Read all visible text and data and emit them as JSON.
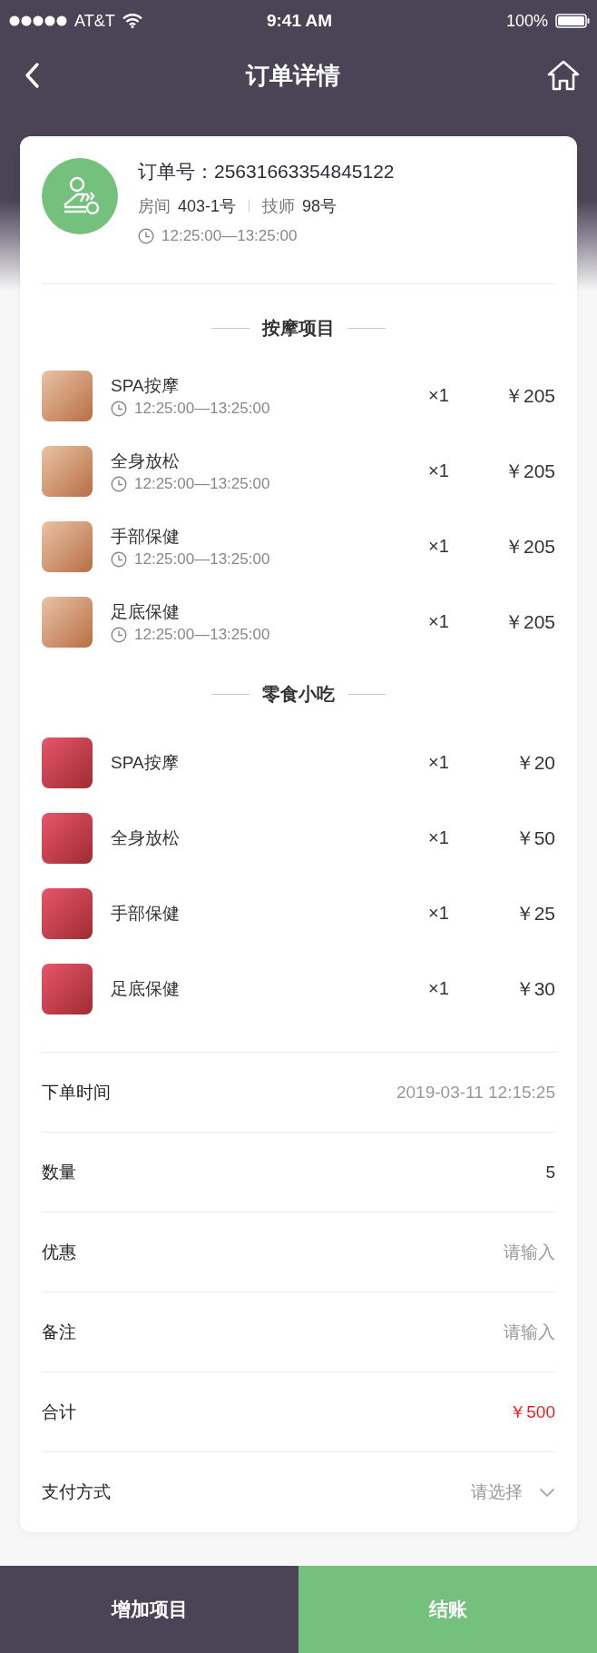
{
  "status_bar": {
    "carrier": "AT&T",
    "time": "9:41 AM",
    "battery": "100%"
  },
  "nav": {
    "title": "订单详情"
  },
  "order": {
    "number": "订单号：25631663354845122",
    "room_label": "房间",
    "room": "403-1号",
    "tech_label": "技师",
    "tech": "98号",
    "time": "12:25:00—13:25:00"
  },
  "sections": [
    {
      "title": "按摩项目",
      "kind": "service",
      "items": [
        {
          "name": "SPA按摩",
          "time": "12:25:00—13:25:00",
          "qty": "×1",
          "price": "￥205"
        },
        {
          "name": "全身放松",
          "time": "12:25:00—13:25:00",
          "qty": "×1",
          "price": "￥205"
        },
        {
          "name": "手部保健",
          "time": "12:25:00—13:25:00",
          "qty": "×1",
          "price": "￥205"
        },
        {
          "name": "足底保健",
          "time": "12:25:00—13:25:00",
          "qty": "×1",
          "price": "￥205"
        }
      ]
    },
    {
      "title": "零食小吃",
      "kind": "snack",
      "items": [
        {
          "name": "SPA按摩",
          "qty": "×1",
          "price": "￥20"
        },
        {
          "name": "全身放松",
          "qty": "×1",
          "price": "￥50"
        },
        {
          "name": "手部保健",
          "qty": "×1",
          "price": "￥25"
        },
        {
          "name": "足底保健",
          "qty": "×1",
          "price": "￥30"
        }
      ]
    }
  ],
  "info_rows": [
    {
      "label": "下单时间",
      "kind": "muted",
      "value": "2019-03-11 12:15:25"
    },
    {
      "label": "数量",
      "kind": "plain",
      "value": "5"
    },
    {
      "label": "优惠",
      "kind": "input",
      "placeholder": "请输入"
    },
    {
      "label": "备注",
      "kind": "input",
      "placeholder": "请输入"
    },
    {
      "label": "合计",
      "kind": "total",
      "value": "￥500"
    },
    {
      "label": "支付方式",
      "kind": "select",
      "placeholder": "请选择"
    }
  ],
  "actions": [
    {
      "label": "增加项目",
      "kind": "secondary"
    },
    {
      "label": "结账",
      "kind": "primary"
    }
  ]
}
